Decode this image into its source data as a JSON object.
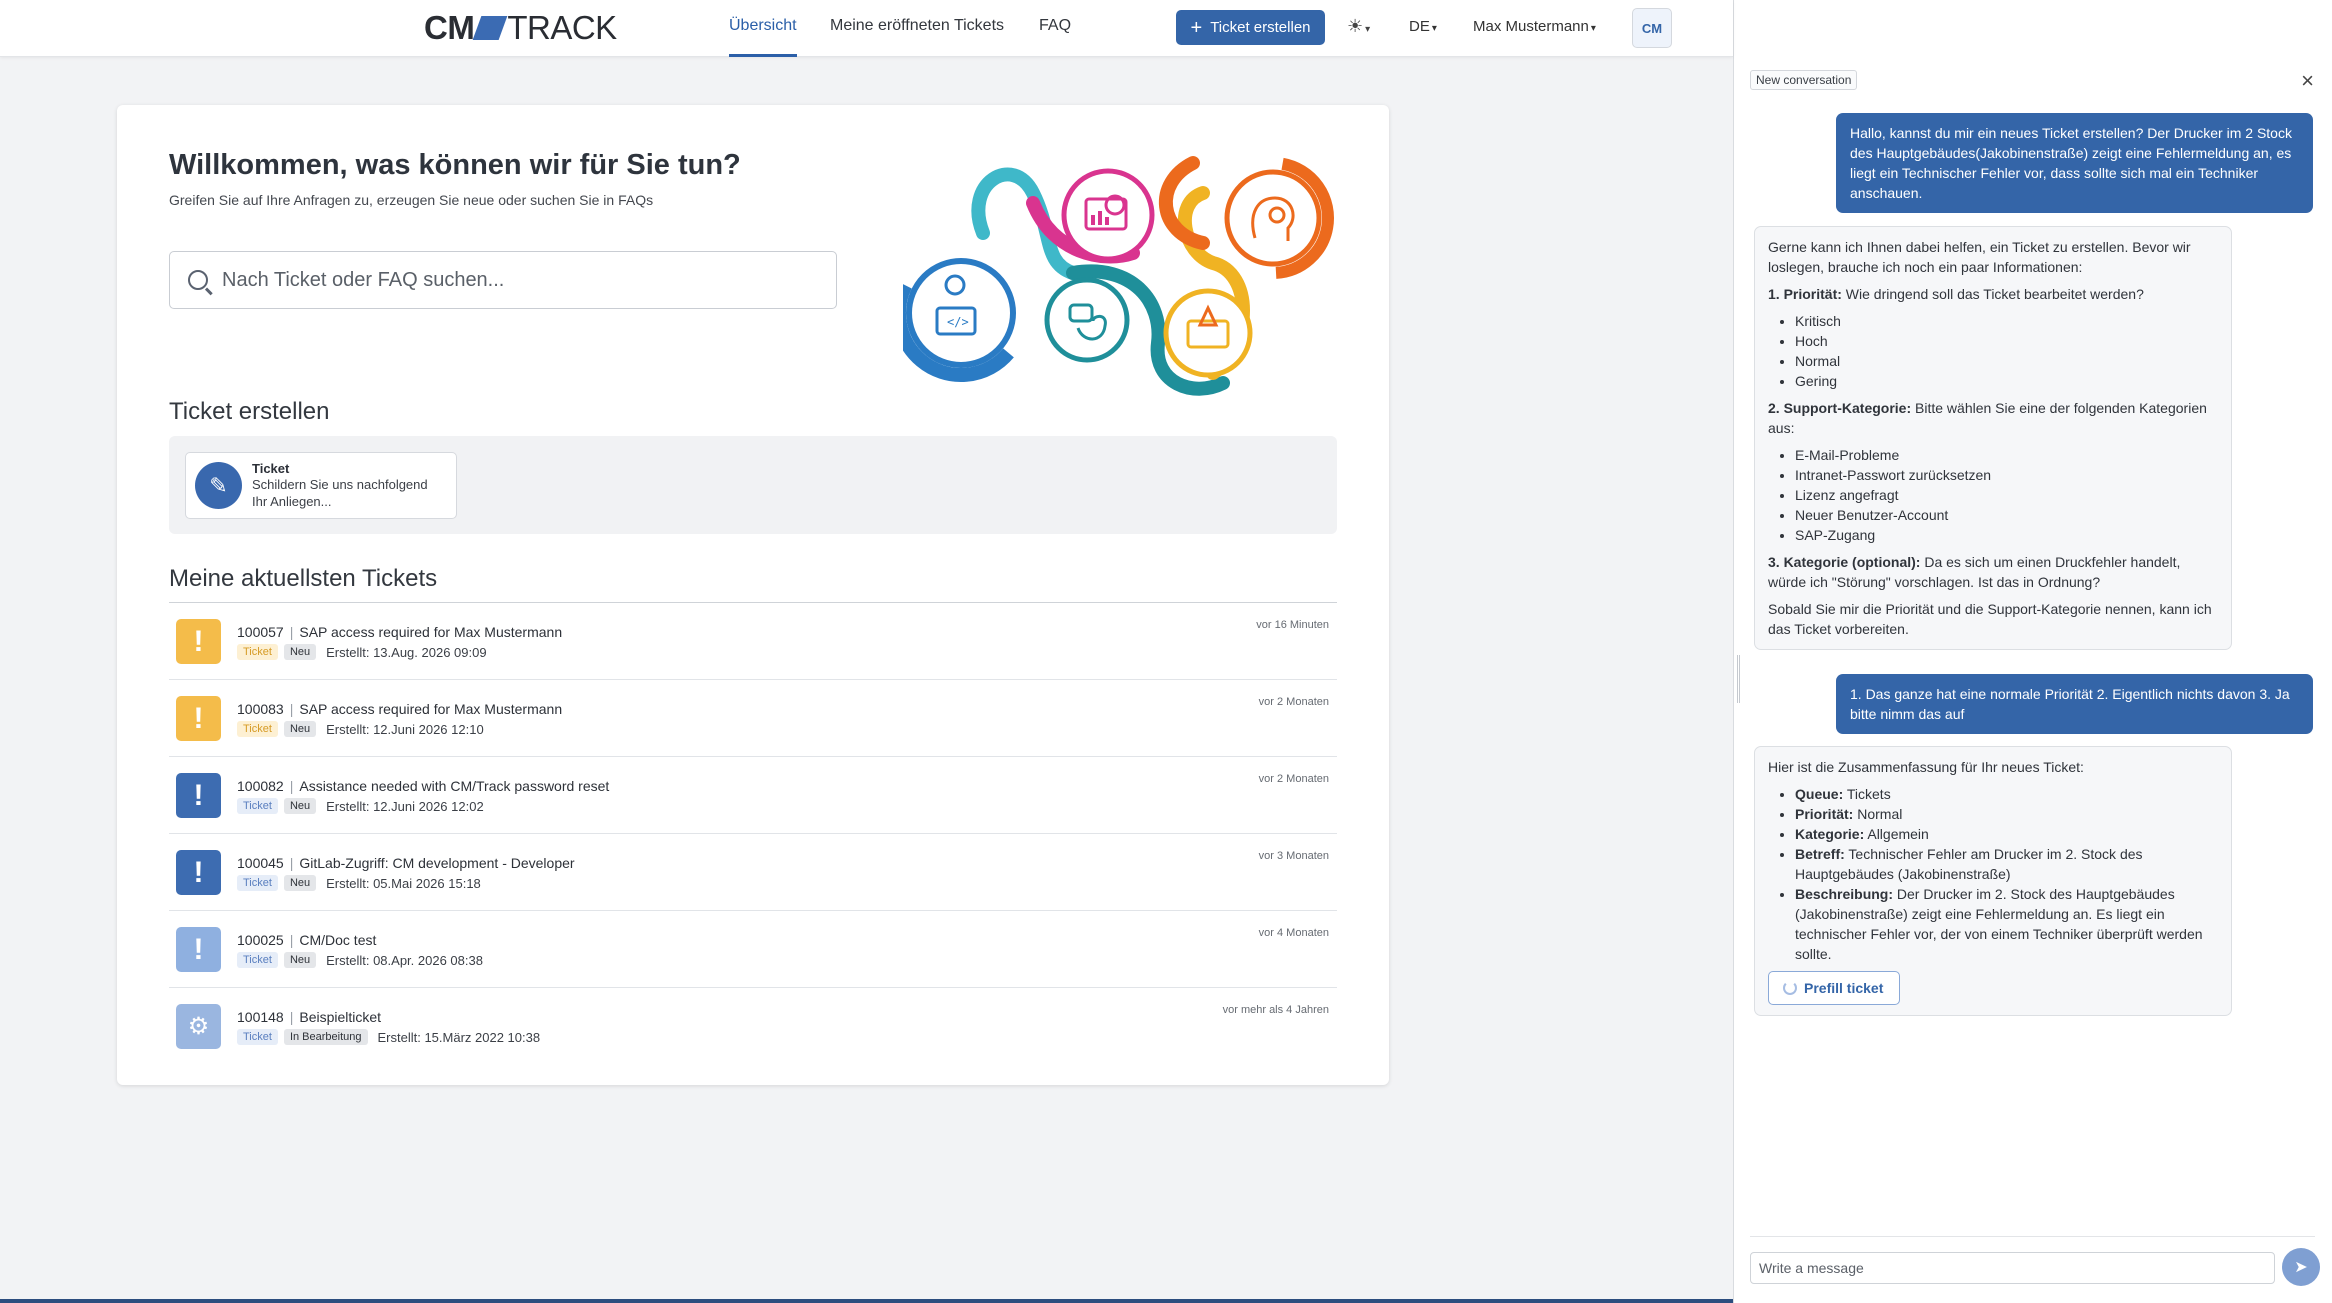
{
  "nav": {
    "logo_cm": "CM",
    "logo_track": "TRACK",
    "links": [
      "Übersicht",
      "Meine eröffneten Tickets",
      "FAQ"
    ],
    "create_button": "Ticket erstellen",
    "lang": "DE",
    "user": "Max Mustermann",
    "assistant_label": "CM"
  },
  "welcome": {
    "title": "Willkommen, was können wir für Sie tun?",
    "subtitle": "Greifen Sie auf Ihre Anfragen zu, erzeugen Sie neue oder suchen Sie in FAQs",
    "search_placeholder": "Nach Ticket oder FAQ suchen..."
  },
  "create_section": {
    "title": "Ticket erstellen",
    "tile_title": "Ticket",
    "tile_desc_line1": "Schildern Sie uns nachfolgend",
    "tile_desc_line2": "Ihr Anliegen..."
  },
  "tickets_section": {
    "title": "Meine aktuellsten Tickets",
    "tickets": [
      {
        "id": "100057",
        "subject": "SAP access required for Max Mustermann",
        "type": "Ticket",
        "status": "Neu",
        "created": "Erstellt: 13.Aug. 2026 09:09",
        "age": "vor 16 Minuten",
        "icon": "exclamation-icon",
        "color": "#f4bc4a"
      },
      {
        "id": "100083",
        "subject": "SAP access required for Max Mustermann",
        "type": "Ticket",
        "status": "Neu",
        "created": "Erstellt: 12.Juni 2026 12:10",
        "age": "vor 2 Monaten",
        "icon": "exclamation-icon",
        "color": "#f4bc4a"
      },
      {
        "id": "100082",
        "subject": "Assistance needed with CM/Track password reset",
        "type": "Ticket",
        "status": "Neu",
        "created": "Erstellt: 12.Juni 2026 12:02",
        "age": "vor 2 Monaten",
        "icon": "exclamation-icon",
        "color": "#3d6cb1"
      },
      {
        "id": "100045",
        "subject": "GitLab-Zugriff: CM development - Developer",
        "type": "Ticket",
        "status": "Neu",
        "created": "Erstellt: 05.Mai 2026 15:18",
        "age": "vor 3 Monaten",
        "icon": "exclamation-icon",
        "color": "#3d6cb1"
      },
      {
        "id": "100025",
        "subject": "CM/Doc test",
        "type": "Ticket",
        "status": "Neu",
        "created": "Erstellt: 08.Apr. 2026 08:38",
        "age": "vor 4 Monaten",
        "icon": "exclamation-icon",
        "color": "#8fb0e0"
      },
      {
        "id": "100148",
        "subject": "Beispielticket",
        "type": "Ticket",
        "status": "In Bearbeitung",
        "created": "Erstellt: 15.März 2022 10:38",
        "age": "vor mehr als 4 Jahren",
        "icon": "gear-icon",
        "color": "#9ab6e0"
      }
    ]
  },
  "chat": {
    "new_conversation": "New conversation",
    "user_msg_1": "Hallo, kannst du mir ein neues Ticket erstellen? Der Drucker im 2 Stock des Hauptgebäudes(Jakobinenstraße) zeigt eine Fehlermeldung an, es liegt ein Technischer Fehler vor, dass sollte sich mal ein Techniker anschauen.",
    "bot_msg_1": {
      "intro": "Gerne kann ich Ihnen dabei helfen, ein Ticket zu erstellen. Bevor wir loslegen, brauche ich noch ein paar Informationen:",
      "q1_label": "1. Priorität:",
      "q1_text": " Wie dringend soll das Ticket bearbeitet werden?",
      "priorities": [
        "Kritisch",
        "Hoch",
        "Normal",
        "Gering"
      ],
      "q2_label": "2. Support-Kategorie:",
      "q2_text": " Bitte wählen Sie eine der folgenden Kategorien aus:",
      "categories": [
        "E-Mail-Probleme",
        "Intranet-Passwort zurücksetzen",
        "Lizenz angefragt",
        "Neuer Benutzer-Account",
        "SAP-Zugang"
      ],
      "q3_label": "3. Kategorie (optional):",
      "q3_text": " Da es sich um einen Druckfehler handelt, würde ich \"Störung\" vorschlagen. Ist das in Ordnung?",
      "outro": "Sobald Sie mir die Priorität und die Support-Kategorie nennen, kann ich das Ticket vorbereiten."
    },
    "user_msg_2": "1. Das ganze hat eine normale Priorität 2. Eigentlich nichts davon 3. Ja bitte nimm das auf",
    "bot_msg_2": {
      "intro": "Hier ist die Zusammenfassung für Ihr neues Ticket:",
      "items": [
        {
          "label": "Queue:",
          "value": " Tickets"
        },
        {
          "label": "Priorität:",
          "value": " Normal"
        },
        {
          "label": "Kategorie:",
          "value": " Allgemein"
        },
        {
          "label": "Betreff:",
          "value": " Technischer Fehler am Drucker im 2. Stock des Hauptgebäudes (Jakobinenstraße)"
        },
        {
          "label": "Beschreibung:",
          "value": " Der Drucker im 2. Stock des Hauptgebäudes (Jakobinenstraße) zeigt eine Fehlermeldung an. Es liegt ein technischer Fehler vor, der von einem Techniker überprüft werden sollte."
        }
      ],
      "prefill_button": "Prefill ticket"
    },
    "input_placeholder": "Write a message"
  }
}
